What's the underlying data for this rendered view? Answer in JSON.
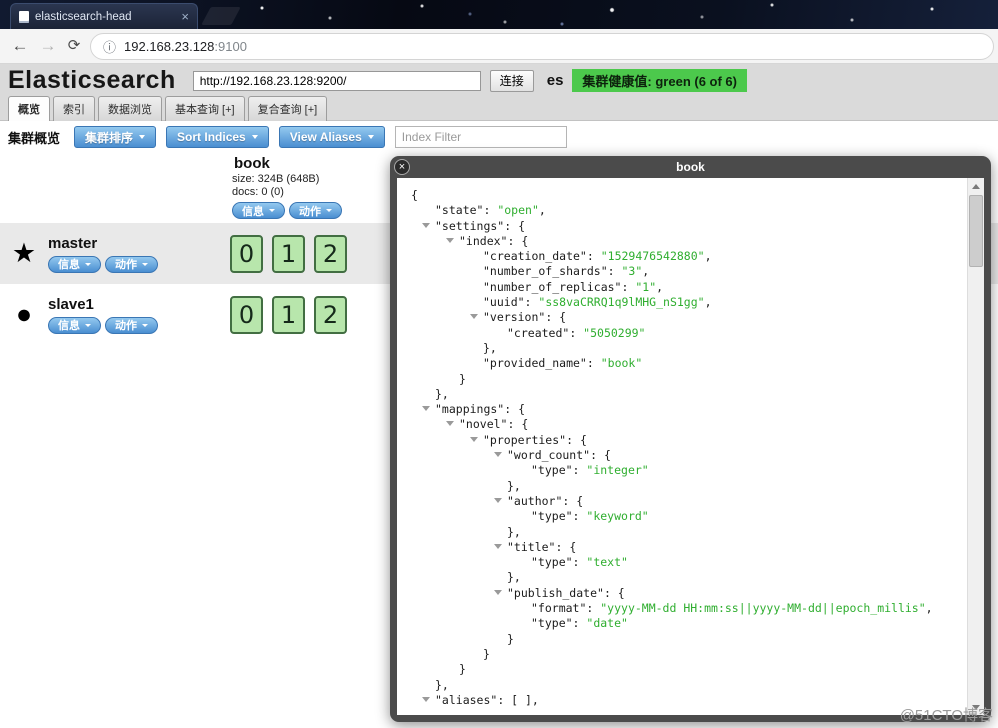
{
  "colors": {
    "health_green": "#4cc94c",
    "shard_green_bg": "#b8e6ac",
    "shard_green_border": "#426e42",
    "button_blue_top": "#94c9ef",
    "button_blue_bottom": "#4a8ed1",
    "button_blue_border": "#3a76b4",
    "json_green": "#2fae2f"
  },
  "browser": {
    "tab_title": "elasticsearch-head",
    "url_host": "192.168.23.128",
    "url_port": ":9100",
    "icons": {
      "back": "←",
      "forward": "→",
      "reload": "⟳",
      "info": "ⓘ",
      "tab_close": "×",
      "close": "×"
    }
  },
  "header": {
    "app_title": "Elasticsearch",
    "endpoint_value": "http://192.168.23.128:9200/",
    "connect_label": "连接",
    "cluster_name": "es",
    "health_label": "集群健康值: green (6 of 6)"
  },
  "tabs": [
    {
      "label": "概览"
    },
    {
      "label": "索引"
    },
    {
      "label": "数据浏览"
    },
    {
      "label": "基本查询 [+]"
    },
    {
      "label": "复合查询 [+]"
    }
  ],
  "toolbar": {
    "overview_label": "集群概览",
    "cluster_sort_label": "集群排序",
    "sort_indices_label": "Sort Indices",
    "view_aliases_label": "View Aliases",
    "index_filter_placeholder": "Index Filter"
  },
  "pill_labels": {
    "info": "信息",
    "actions": "动作"
  },
  "index_header": {
    "name": "book",
    "size": "size: 324B (648B)",
    "docs": "docs: 0 (0)"
  },
  "nodes": [
    {
      "name": "master",
      "icon_char": "★",
      "shards": [
        "0",
        "1",
        "2"
      ]
    },
    {
      "name": "slave1",
      "icon_char": "●",
      "shards": [
        "0",
        "1",
        "2"
      ]
    }
  ],
  "modal": {
    "title": "book",
    "json_lines": [
      {
        "i": 0,
        "p": "{"
      },
      {
        "i": 1,
        "k": "state",
        "v": "open",
        "p": ","
      },
      {
        "i": 1,
        "a": true,
        "k": "settings",
        "p": ": {"
      },
      {
        "i": 2,
        "a": true,
        "k": "index",
        "p": ": {"
      },
      {
        "i": 3,
        "k": "creation_date",
        "v": "1529476542880",
        "p": ","
      },
      {
        "i": 3,
        "k": "number_of_shards",
        "v": "3",
        "p": ","
      },
      {
        "i": 3,
        "k": "number_of_replicas",
        "v": "1",
        "p": ","
      },
      {
        "i": 3,
        "k": "uuid",
        "v": "ss8vaCRRQ1q9lMHG_nS1gg",
        "p": ","
      },
      {
        "i": 3,
        "a": true,
        "k": "version",
        "p": ": {"
      },
      {
        "i": 4,
        "k": "created",
        "v": "5050299",
        "p": ""
      },
      {
        "i": 3,
        "p": "},"
      },
      {
        "i": 3,
        "k": "provided_name",
        "v": "book",
        "p": ""
      },
      {
        "i": 2,
        "p": "}"
      },
      {
        "i": 1,
        "p": "},"
      },
      {
        "i": 1,
        "a": true,
        "k": "mappings",
        "p": ": {"
      },
      {
        "i": 2,
        "a": true,
        "k": "novel",
        "p": ": {"
      },
      {
        "i": 3,
        "a": true,
        "k": "properties",
        "p": ": {"
      },
      {
        "i": 4,
        "a": true,
        "k": "word_count",
        "p": ": {"
      },
      {
        "i": 5,
        "k": "type",
        "v": "integer",
        "p": ""
      },
      {
        "i": 4,
        "p": "},"
      },
      {
        "i": 4,
        "a": true,
        "k": "author",
        "p": ": {"
      },
      {
        "i": 5,
        "k": "type",
        "v": "keyword",
        "p": ""
      },
      {
        "i": 4,
        "p": "},"
      },
      {
        "i": 4,
        "a": true,
        "k": "title",
        "p": ": {"
      },
      {
        "i": 5,
        "k": "type",
        "v": "text",
        "p": ""
      },
      {
        "i": 4,
        "p": "},"
      },
      {
        "i": 4,
        "a": true,
        "k": "publish_date",
        "p": ": {"
      },
      {
        "i": 5,
        "k": "format",
        "v": "yyyy-MM-dd HH:mm:ss||yyyy-MM-dd||epoch_millis",
        "p": ","
      },
      {
        "i": 5,
        "k": "type",
        "v": "date",
        "p": ""
      },
      {
        "i": 4,
        "p": "}"
      },
      {
        "i": 3,
        "p": "}"
      },
      {
        "i": 2,
        "p": "}"
      },
      {
        "i": 1,
        "p": "},"
      },
      {
        "i": 1,
        "a": true,
        "k": "aliases",
        "p": ": [ ],"
      }
    ]
  },
  "watermark": "@51CTO博客"
}
